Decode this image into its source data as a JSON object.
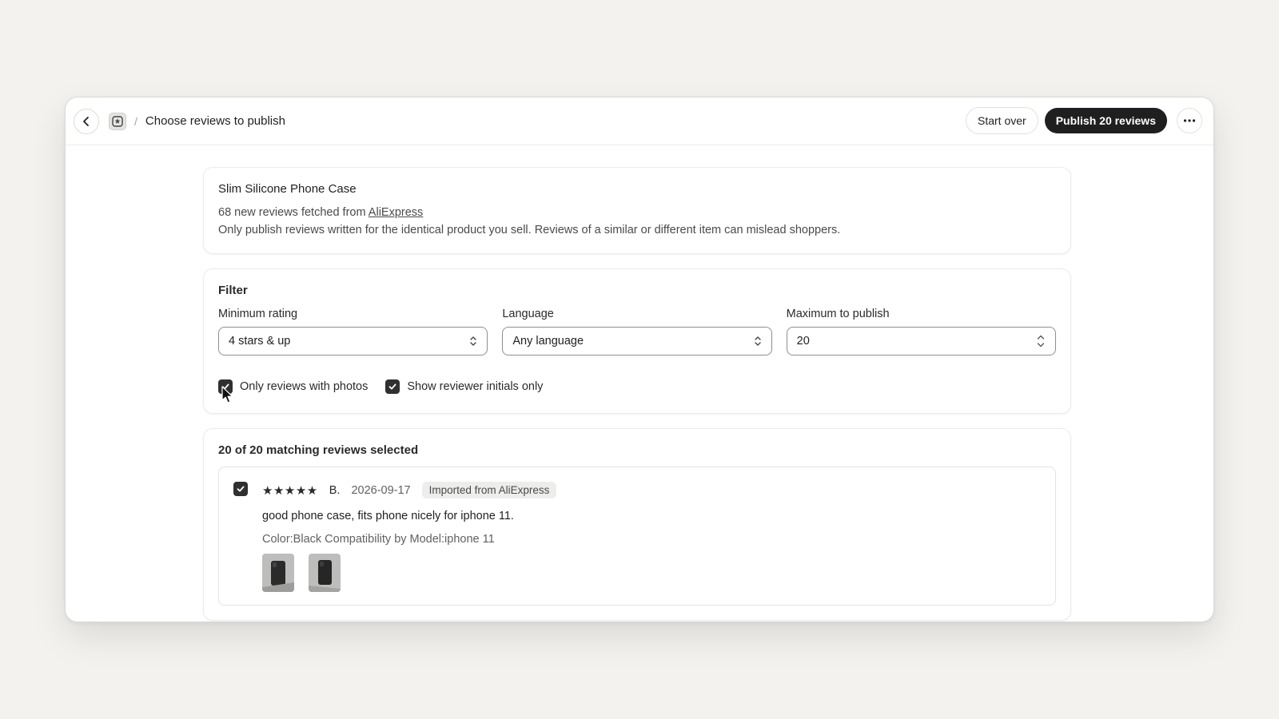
{
  "header": {
    "title": "Choose reviews to publish",
    "breadcrumb_separator": "/",
    "start_over_label": "Start over",
    "publish_label": "Publish 20 reviews",
    "more_label": "···"
  },
  "product": {
    "name": "Slim Silicone Phone Case",
    "fetched_prefix": "68 new reviews fetched from ",
    "source_link": "AliExpress",
    "warning": "Only publish reviews written for the identical product you sell. Reviews of a similar or different item can mislead shoppers."
  },
  "filter": {
    "title": "Filter",
    "min_rating": {
      "label": "Minimum rating",
      "value": "4 stars & up"
    },
    "language": {
      "label": "Language",
      "value": "Any language"
    },
    "max_publish": {
      "label": "Maximum to publish",
      "value": "20"
    },
    "only_photos": {
      "label": "Only reviews with photos",
      "checked": true
    },
    "initials_only": {
      "label": "Show reviewer initials only",
      "checked": true
    }
  },
  "reviews": {
    "summary": "20 of 20 matching reviews selected",
    "items": [
      {
        "selected": true,
        "stars": "★★★★★",
        "rating": 5,
        "reviewer": "B.",
        "date": "2026-09-17",
        "badge": "Imported from AliExpress",
        "text": "good phone case, fits phone nicely for iphone 11.",
        "variant": "Color:Black Compatibility by Model:iphone 11",
        "photo_count": 2
      }
    ]
  },
  "colors": {
    "background": "#f3f2ef",
    "primary_button": "#1f1f1f",
    "checkbox": "#303030",
    "badge_bg": "#ededeb"
  }
}
